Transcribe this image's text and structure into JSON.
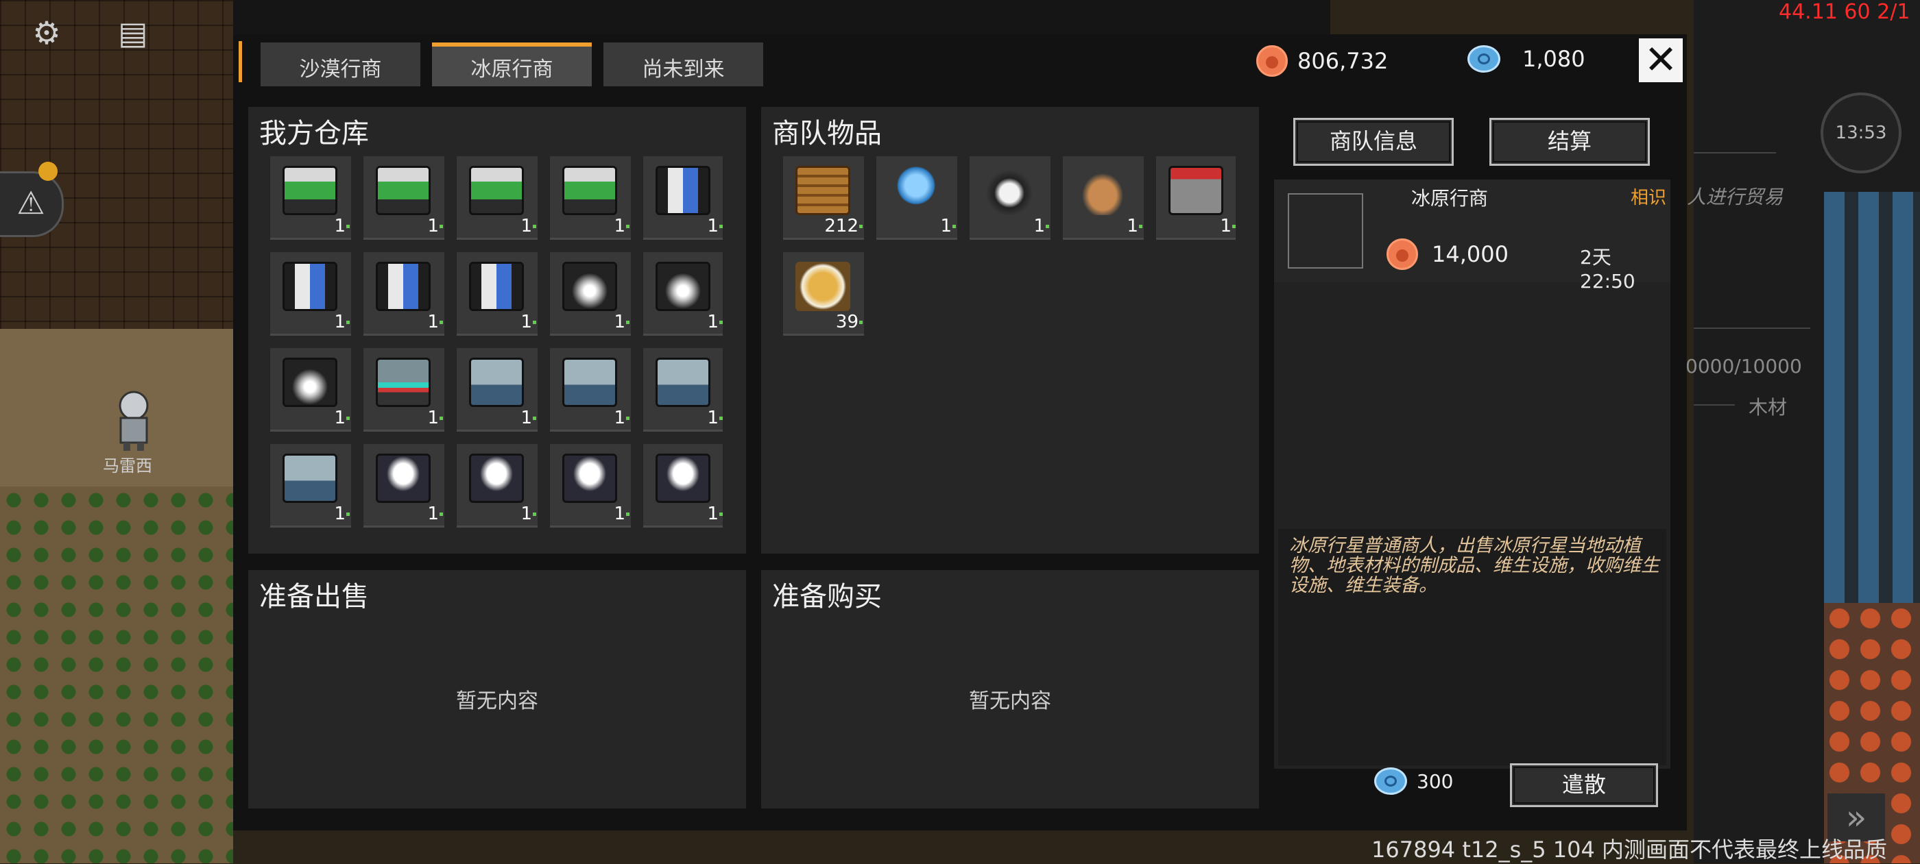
{
  "hud": {
    "settings_icon": "gear-icon",
    "chat_icon": "chat-icon",
    "alert_icon": "warning-icon",
    "pawn_name": "马雷西",
    "perf_text": "44.11 60 2/1",
    "clock_time": "13:53",
    "bg_text_1": "人进行贸易",
    "bg_text_2": "0000/10000",
    "bg_text_3": "木材",
    "watermark": "167894 t12_s_5 104 内测画面不代表最终上线品质"
  },
  "dialog": {
    "tabs": [
      {
        "label": "沙漠行商",
        "active": false
      },
      {
        "label": "冰原行商",
        "active": true
      },
      {
        "label": "尚未到来",
        "active": false
      }
    ],
    "silver_amount": "806,732",
    "gem_amount": "1,080",
    "close_symbol": "✕",
    "warehouse": {
      "title": "我方仓库",
      "items": [
        {
          "icon": "med",
          "qty": "1"
        },
        {
          "icon": "med",
          "qty": "1"
        },
        {
          "icon": "med",
          "qty": "1"
        },
        {
          "icon": "med",
          "qty": "1"
        },
        {
          "icon": "cabinet",
          "qty": "1"
        },
        {
          "icon": "cabinet",
          "qty": "1"
        },
        {
          "icon": "cabinet",
          "qty": "1"
        },
        {
          "icon": "cabinet",
          "qty": "1"
        },
        {
          "icon": "turret",
          "qty": "1"
        },
        {
          "icon": "turret",
          "qty": "1"
        },
        {
          "icon": "turret",
          "qty": "1"
        },
        {
          "icon": "console",
          "qty": "1"
        },
        {
          "icon": "locker",
          "qty": "1"
        },
        {
          "icon": "locker",
          "qty": "1"
        },
        {
          "icon": "locker",
          "qty": "1"
        },
        {
          "icon": "locker",
          "qty": "1"
        },
        {
          "icon": "lamp",
          "qty": "1"
        },
        {
          "icon": "lamp",
          "qty": "1"
        },
        {
          "icon": "lamp",
          "qty": "1"
        },
        {
          "icon": "lamp",
          "qty": "1"
        },
        {
          "icon": "lamp",
          "qty": ""
        },
        {
          "icon": "lamp",
          "qty": ""
        },
        {
          "icon": "lamp",
          "qty": ""
        },
        {
          "icon": "lamp",
          "qty": ""
        },
        {
          "icon": "lamp",
          "qty": ""
        }
      ]
    },
    "caravan": {
      "title": "商队物品",
      "items": [
        {
          "icon": "crate",
          "qty": "212"
        },
        {
          "icon": "jelly",
          "qty": "1"
        },
        {
          "icon": "penguin",
          "qty": "1"
        },
        {
          "icon": "deer",
          "qty": "1"
        },
        {
          "icon": "mech",
          "qty": "1"
        },
        {
          "icon": "food",
          "qty": "39"
        }
      ]
    },
    "sell": {
      "title": "准备出售",
      "empty": "暂无内容"
    },
    "buy": {
      "title": "准备购买",
      "empty": "暂无内容"
    },
    "info_button": "商队信息",
    "settle_button": "结算",
    "trader": {
      "name": "冰原行商",
      "relation": "相识",
      "silver": "14,000",
      "time_left": "2天 22:50",
      "description": "冰原行星普通商人，出售冰原行星当地动植物、地表材料的制成品、维生设施，收购维生设施、维生装备。"
    },
    "dismiss_cost": "300",
    "dismiss_button": "遣散"
  }
}
